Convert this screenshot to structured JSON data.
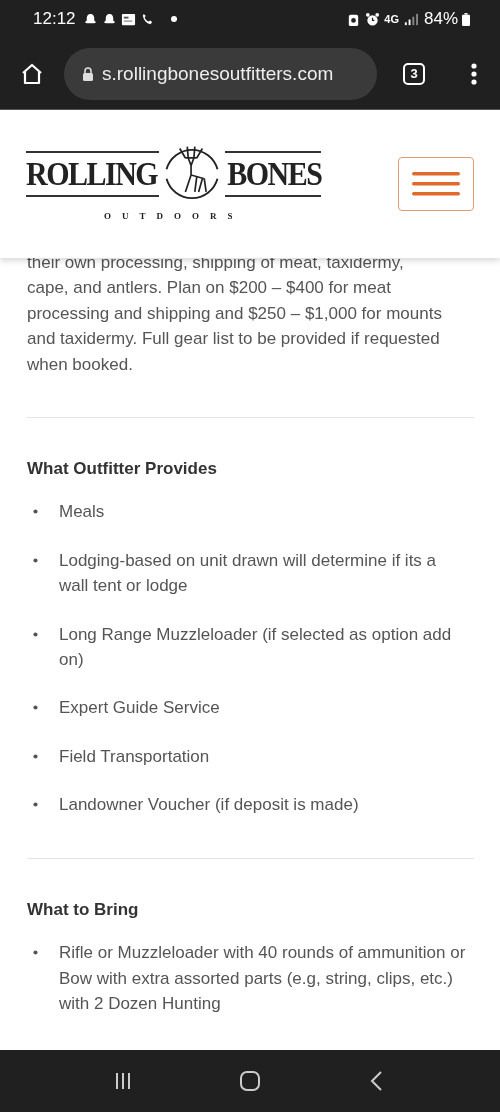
{
  "status_bar": {
    "time": "12:12",
    "network": "4G",
    "battery": "84%"
  },
  "browser": {
    "url": "s.rollingbonesoutfitters.com",
    "tab_count": "3"
  },
  "header": {
    "logo": {
      "word_1": "ROLLING",
      "word_2": "BONES",
      "tagline": "OUTDOORS"
    }
  },
  "intro_paragraph": "their own processing, shipping of meat, taxidermy, cape, and antlers. Plan on $200 – $400 for meat processing and shipping and $250 – $1,000 for mounts and taxidermy. Full gear list to be provided if requested when booked.",
  "sections": [
    {
      "heading": "What Outfitter Provides",
      "items": [
        "Meals",
        "Lodging-based on unit drawn will determine if its a wall tent or lodge",
        "Long Range Muzzleloader (if selected as option add on)",
        "Expert Guide Service",
        "Field Transportation",
        "Landowner Voucher (if deposit is made)"
      ]
    },
    {
      "heading": "What to Bring",
      "items": [
        "Rifle or Muzzleloader with 40 rounds of ammunition or Bow with extra assorted parts (e.g, string, clips, etc.) with 2 Dozen Hunting"
      ]
    }
  ]
}
